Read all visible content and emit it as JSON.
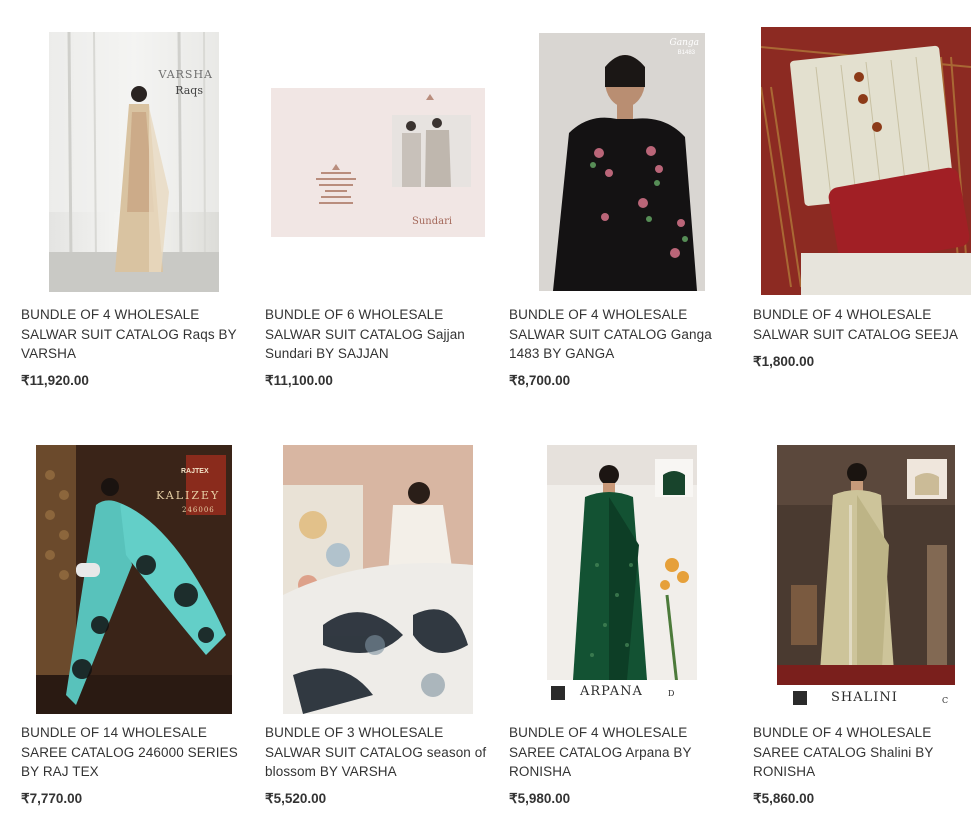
{
  "products": [
    {
      "title": "BUNDLE OF 4 WHOLESALE SALWAR SUIT CATALOG Raqs BY VARSHA",
      "price": "₹11,920.00",
      "image_brand": "VARSHA",
      "image_caption": "Raqs"
    },
    {
      "title": "BUNDLE OF 6 WHOLESALE SALWAR SUIT CATALOG Sajjan Sundari BY SAJJAN",
      "price": "₹11,100.00",
      "image_caption": "Sundari"
    },
    {
      "title": "BUNDLE OF 4 WHOLESALE SALWAR SUIT CATALOG Ganga 1483 BY GANGA",
      "price": "₹8,700.00",
      "image_brand": "Ganga",
      "image_code": "B1483"
    },
    {
      "title": "BUNDLE OF 4 WHOLESALE SALWAR SUIT CATALOG SEEJA",
      "price": "₹1,800.00"
    },
    {
      "title": "BUNDLE OF 14 WHOLESALE SAREE CATALOG 246000 SERIES BY RAJ TEX",
      "price": "₹7,770.00",
      "image_brand": "RAJTEX",
      "image_caption": "KALIZEY",
      "image_code": "246006"
    },
    {
      "title": "BUNDLE OF 3 WHOLESALE SALWAR SUIT CATALOG season of blossom BY VARSHA",
      "price": "₹5,520.00"
    },
    {
      "title": "BUNDLE OF 4 WHOLESALE SAREE CATALOG Arpana BY RONISHA",
      "price": "₹5,980.00",
      "image_caption": "ARPANA",
      "image_code": "D"
    },
    {
      "title": "BUNDLE OF 4 WHOLESALE SAREE CATALOG Shalini BY RONISHA",
      "price": "₹5,860.00",
      "image_caption": "SHALINI",
      "image_code": "C"
    }
  ],
  "colors": {
    "text": "#333333",
    "background": "#ffffff"
  }
}
